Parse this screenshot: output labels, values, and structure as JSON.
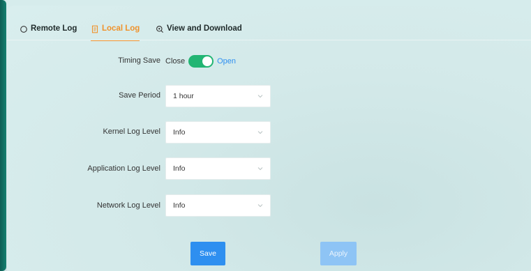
{
  "tabs": [
    {
      "label": "Remote Log",
      "icon": "circle-icon",
      "active": false
    },
    {
      "label": "Local Log",
      "icon": "document-icon",
      "active": true
    },
    {
      "label": "View and Download",
      "icon": "magnifier-icon",
      "active": false
    }
  ],
  "form": {
    "timing_save": {
      "label": "Timing Save",
      "off_text": "Close",
      "on_text": "Open",
      "value": "Open"
    },
    "save_period": {
      "label": "Save Period",
      "value": "1 hour"
    },
    "kernel_log_level": {
      "label": "Kernel Log Level",
      "value": "Info"
    },
    "application_log_level": {
      "label": "Application Log Level",
      "value": "Info"
    },
    "network_log_level": {
      "label": "Network Log Level",
      "value": "Info"
    }
  },
  "buttons": {
    "save": "Save",
    "apply": "Apply"
  },
  "colors": {
    "accent_tab": "#f0922b",
    "toggle_on": "#22b573",
    "primary": "#2e8ff0",
    "disabled_primary": "#8ec4f5"
  }
}
